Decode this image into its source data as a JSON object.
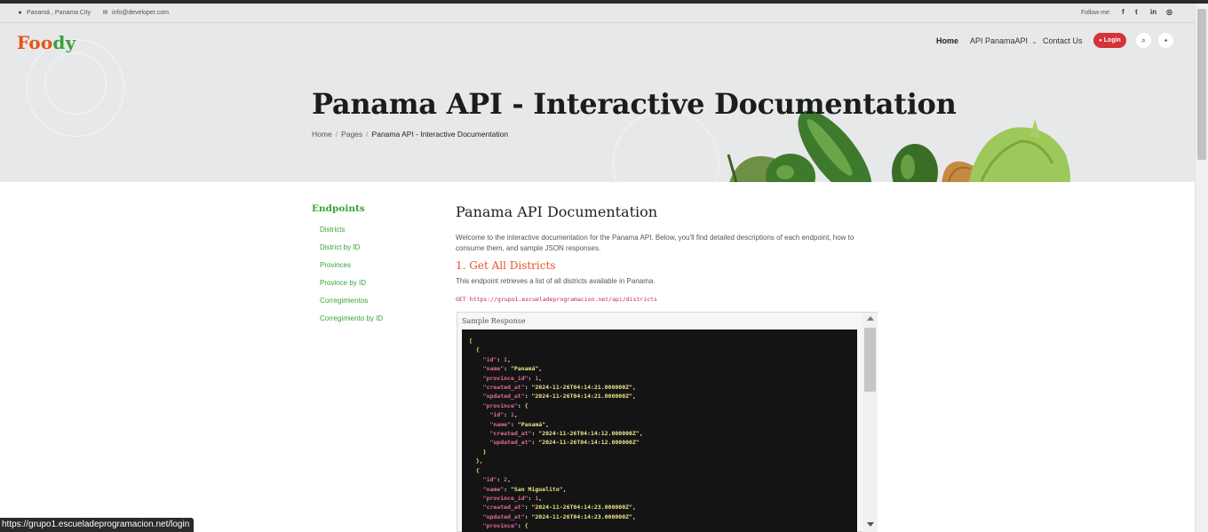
{
  "topbar": {
    "location": "Panamá , Panama City",
    "email": "info@developer.com",
    "follow_label": "Follow me:",
    "socials": [
      "facebook-icon",
      "twitter-icon",
      "linkedin-icon",
      "instagram-icon"
    ]
  },
  "logo": {
    "part1": "Foo",
    "part2": "dy"
  },
  "nav": {
    "home": "Home",
    "api": "API PanamaAPI",
    "contact": "Contact Us",
    "login": "Login"
  },
  "hero": {
    "title": "Panama API - Interactive Documentation",
    "breadcrumb": [
      "Home",
      "Pages",
      "Panama API - Interactive Documentation"
    ]
  },
  "sidebar": {
    "title": "Endpoints",
    "items": [
      "Districts",
      "District by ID",
      "Provinces",
      "Province by ID",
      "Corregimientos",
      "Corregimiento by ID"
    ]
  },
  "doc": {
    "title": "Panama API Documentation",
    "intro": "Welcome to the interactive documentation for the Panama API. Below, you'll find detailed descriptions of each endpoint, how to consume them, and sample JSON responses.",
    "endpoint_title": "1. Get All Districts",
    "endpoint_desc": "This endpoint retrieves a list of all districts available in Panama.",
    "endpoint_code": "GET https://grupo1.escueladeprogramacion.net/api/districts",
    "sample_label": "Sample Response"
  },
  "status_url": "https://grupo1.escueladeprogramacion.net/login",
  "colors": {
    "brand_orange": "#e8531c",
    "brand_green": "#3aa336",
    "login_red": "#d6323a",
    "code_bg": "#141414"
  }
}
